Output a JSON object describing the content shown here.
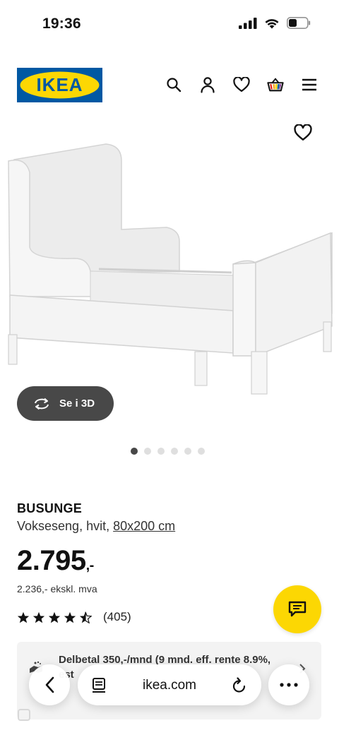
{
  "status_bar": {
    "time": "19:36"
  },
  "header": {
    "logo_text": "IKEA",
    "icons": [
      "search-icon",
      "account-icon",
      "heart-icon",
      "basket-icon",
      "menu-icon"
    ]
  },
  "gallery": {
    "view_3d_label": "Se i 3D",
    "dot_count": 6,
    "active_index": 0
  },
  "product": {
    "name": "BUSUNGE",
    "description": "Vokseseng, hvit,",
    "size": "80x200 cm",
    "price": "2.795",
    "price_suffix": ",-",
    "price_ex_vat": "2.236,- ekskl. mva",
    "rating": 4.5,
    "review_count": "(405)"
  },
  "financing": {
    "text_line1": "Delbetal 350,-/mnd (9 mnd. eff. rente 8.9%,",
    "text_line2": "est"
  },
  "browser": {
    "url": "ikea.com"
  },
  "colors": {
    "ikea_blue": "#0058a3",
    "ikea_yellow": "#fcd703",
    "dark_button": "#484848"
  }
}
